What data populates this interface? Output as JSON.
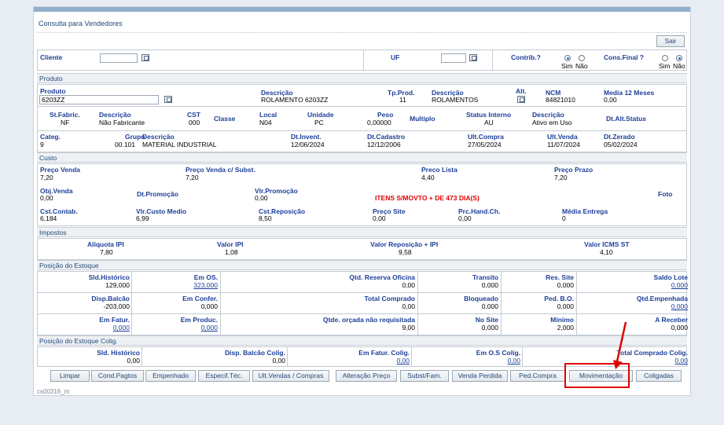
{
  "page": {
    "title": "Consulta para Vendedores",
    "exit_label": "Sair",
    "footer_code": "cs00316_m"
  },
  "header_row": {
    "cliente_label": "Cliente",
    "uf_label": "UF",
    "contrib_label": "Contrib.?",
    "contrib_sim": "Sim",
    "contrib_nao": "Não",
    "consfinal_label": "Cons.Final ?",
    "consfinal_sim": "Sim",
    "consfinal_nao": "Não"
  },
  "produto": {
    "section_title": "Produto",
    "r1": {
      "produto_label": "Produto",
      "produto_value": "6203ZZ",
      "desc_label": "Descrição",
      "desc_value": "ROLAMENTO 6203ZZ",
      "tpprod_label": "Tp.Prod.",
      "tpprod_value": "11",
      "desc2_label": "Descrição",
      "desc2_value": "ROLAMENTOS",
      "alt_label": "Alt.",
      "ncm_label": "NCM",
      "ncm_value": "84821010",
      "media_label": "Media 12 Meses",
      "media_value": "0,00"
    },
    "r2": {
      "stfabric_label": "St.Fabric.",
      "stfabric_value": "NF",
      "desc_label": "Descrição",
      "desc_value": "Não Fabricante",
      "cst_label": "CST",
      "cst_value": "000",
      "classe_label": "Classe",
      "local_label": "Local",
      "local_value": "N04",
      "unidade_label": "Unidade",
      "unidade_value": "PC",
      "peso_label": "Peso",
      "peso_value": "0,00000",
      "multiplo_label": "Multiplo",
      "status_label": "Status Interno",
      "status_value": "AU",
      "desc3_label": "Descrição",
      "desc3_value": "Ativo em Uso",
      "dtalt_label": "Dt.Alt.Status"
    },
    "r3": {
      "categ_label": "Categ.",
      "categ_value": "9",
      "grupo_label": "Grupo",
      "grupo_value": "00.101",
      "desc_label": "Descrição",
      "desc_value": "MATERIAL INDUSTRIAL",
      "dtinvent_label": "Dt.Invent.",
      "dtinvent_value": "12/06/2024",
      "dtcad_label": "Dt.Cadastro",
      "dtcad_value": "12/12/2006",
      "ultcompra_label": "Ult.Compra",
      "ultcompra_value": "27/05/2024",
      "ultvenda_label": "Ult.Venda",
      "ultvenda_value": "11/07/2024",
      "dtzerado_label": "Dt.Zerado",
      "dtzerado_value": "05/02/2024"
    }
  },
  "custo": {
    "section_title": "Custo",
    "pvenda_label": "Preço Venda",
    "pvenda_value": "7,20",
    "pvendast_label": "Preço Venda c/ Subst.",
    "pvendast_value": "7,20",
    "plista_label": "Preco Lista",
    "plista_value": "4,40",
    "pprazo_label": "Preço Prazo",
    "pprazo_value": "7,20",
    "objvenda_label": "Obj.Venda",
    "objvenda_value": "0,00",
    "dtpromo_label": "Dt.Promoção",
    "vlrpromo_label": "Vlr.Promoção",
    "vlrpromo_value": "0,00",
    "alert": "ITENS S/MOVTO + DE 473 DIA(S)",
    "foto_label": "Foto",
    "cstcontab_label": "Cst.Contab.",
    "cstcontab_value": "6,184",
    "vlrcusto_label": "Vlr.Custo Medio",
    "vlrcusto_value": "6,99",
    "cstrepos_label": "Cst.Reposição",
    "cstrepos_value": "8,50",
    "psite_label": "Preço Site",
    "psite_value": "0,00",
    "prchand_label": "Prc.Hand.Ch.",
    "prchand_value": "0,00",
    "mediaentrega_label": "Média Entrega",
    "mediaentrega_value": "0"
  },
  "impostos": {
    "section_title": "Impostos",
    "aliq_label": "Alíquota IPI",
    "aliq_value": "7,80",
    "valoripi_label": "Valor IPI",
    "valoripi_value": "1,08",
    "valorrep_label": "Valor Reposição + IPI",
    "valorrep_value": "9,58",
    "icmsst_label": "Valor ICMS ST",
    "icmsst_value": "4,10"
  },
  "estoque": {
    "section_title": "Posição do Estoque",
    "rows": [
      [
        {
          "label": "Sld.Histórico",
          "value": "129,000"
        },
        {
          "label": "Em OS.",
          "value": "323,000",
          "link": true
        },
        {
          "label": "Qtd. Reserva Oficina",
          "value": "0,00"
        },
        {
          "label": "Transito",
          "value": "0,000"
        },
        {
          "label": "Res. Site",
          "value": "0,000"
        },
        {
          "label": "Saldo Lote",
          "value": "0,000",
          "link": true
        }
      ],
      [
        {
          "label": "Disp.Balcão",
          "value": "-203,000"
        },
        {
          "label": "Em Confer.",
          "value": "0,000"
        },
        {
          "label": "Total Comprado",
          "value": "0,00"
        },
        {
          "label": "Bloqueado",
          "value": "0,000"
        },
        {
          "label": "Ped. B.O.",
          "value": "0,000"
        },
        {
          "label": "Qtd.Empenhada",
          "value": "0,000",
          "link": true
        }
      ],
      [
        {
          "label": "Em Fatur.",
          "value": "0,000",
          "link": true
        },
        {
          "label": "Em Produc.",
          "value": "0,000",
          "link": true
        },
        {
          "label": "Qtde. orçada não requisitada",
          "value": "9,00"
        },
        {
          "label": "No Site",
          "value": "0,000"
        },
        {
          "label": "Mínimo",
          "value": "2,000"
        },
        {
          "label": "A Receber",
          "value": "0,000"
        }
      ]
    ]
  },
  "coligadas": {
    "section_title": "Posição do Estoque Colig.",
    "cells": [
      {
        "label": "Sld. Histórico",
        "value": "0,00"
      },
      {
        "label": "Disp. Balcão Colig.",
        "value": "0,00"
      },
      {
        "label": "Em Fatur. Colig.",
        "value": "0,00",
        "link": true
      },
      {
        "label": "Em O.S Colig.",
        "value": "0,00",
        "link": true
      },
      {
        "label": "Total Comprado Colig.",
        "value": "0,00",
        "link": true
      }
    ]
  },
  "buttons": [
    "Limpar",
    "Cond.Pagtos",
    "Empenhado",
    "Especif.Téc.",
    "Ult.Vendas / Compras",
    "Alteração Preço",
    "Subst/Fam.",
    "Venda Perdida",
    "Ped.Compra",
    "Movimentação",
    "Coligadas"
  ],
  "colors": {
    "label": "#1d3f99",
    "alert": "#e00000",
    "highlight": "#e00000",
    "section_bg": "#eef1f4"
  }
}
